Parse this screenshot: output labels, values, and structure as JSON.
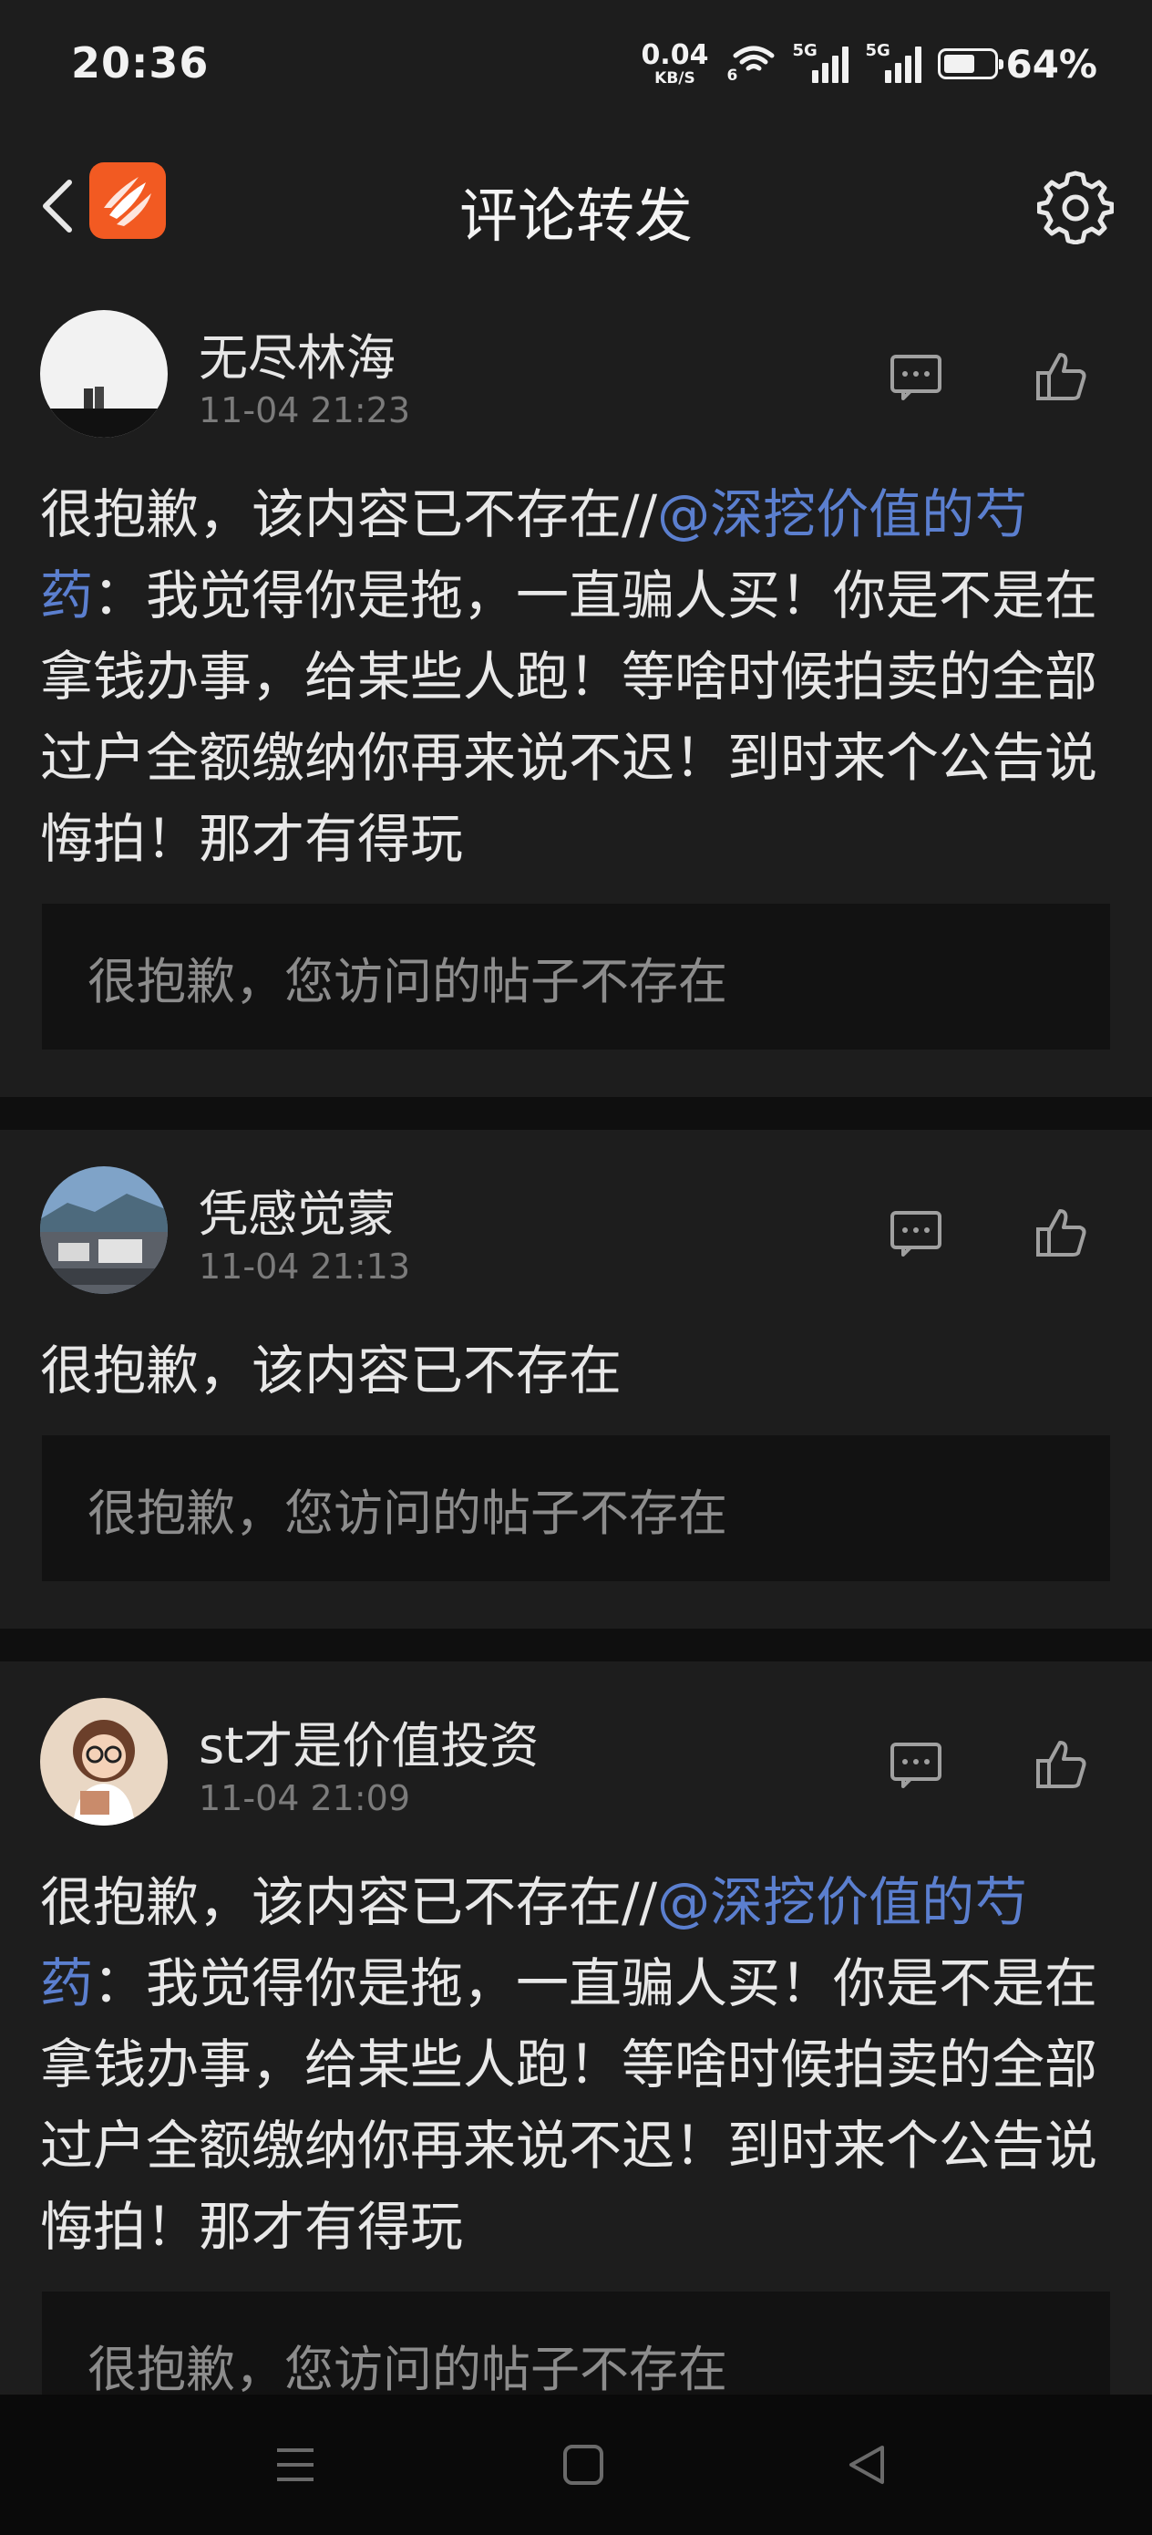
{
  "status_bar": {
    "time": "20:36",
    "net_speed_value": "0.04",
    "net_speed_unit": "KB/S",
    "wifi_label": "6",
    "signal_1_label": "5G",
    "signal_2_label": "5G",
    "battery_percent": "64%",
    "battery_level": 0.64
  },
  "header": {
    "title": "评论转发",
    "back_icon": "chevron-left-icon",
    "logo_icon": "app-logo-icon",
    "settings_icon": "gear-icon"
  },
  "posts": [
    {
      "username": "无尽林海",
      "timestamp": "11-04 21:23",
      "text_before": "很抱歉，该内容已不存在//",
      "mention": "@深挖价值的芍药",
      "text_after": "：我觉得你是拖，一直骗人买！你是不是在拿钱办事，给某些人跑！等啥时候拍卖的全部过户全额缴纳你再来说不迟！到时来个公告说悔拍！那才有得玩",
      "quote": "很抱歉，您访问的帖子不存在"
    },
    {
      "username": "凭感觉蒙",
      "timestamp": "11-04 21:13",
      "text_before": "很抱歉，该内容已不存在",
      "mention": "",
      "text_after": "",
      "quote": "很抱歉，您访问的帖子不存在"
    },
    {
      "username": "st才是价值投资",
      "timestamp": "11-04 21:09",
      "text_before": "很抱歉，该内容已不存在//",
      "mention": "@深挖价值的芍药",
      "text_after": "：我觉得你是拖，一直骗人买！你是不是在拿钱办事，给某些人跑！等啥时候拍卖的全部过户全额缴纳你再来说不迟！到时来个公告说悔拍！那才有得玩",
      "quote": "很抱歉，您访问的帖子不存在"
    }
  ],
  "nav_bar": {
    "menu_icon": "menu-icon",
    "home_icon": "home-square-icon",
    "back_icon": "back-triangle-icon"
  },
  "colors": {
    "background": "#0f0f0f",
    "card": "#1d1d1d",
    "quote_box": "#121212",
    "mention": "#5b7fcf",
    "brand": "#f25a22",
    "timestamp": "#7b7b7b"
  }
}
